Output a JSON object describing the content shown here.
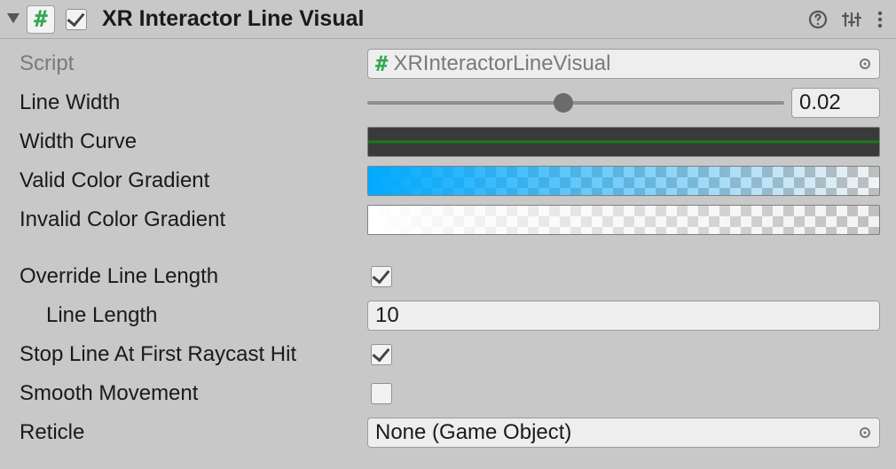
{
  "header": {
    "title": "XR Interactor Line Visual",
    "enabled": true
  },
  "fields": {
    "script_label": "Script",
    "script_value": "XRInteractorLineVisual",
    "line_width_label": "Line Width",
    "line_width_value": "0.02",
    "line_width_slider_pos": 47,
    "width_curve_label": "Width Curve",
    "valid_gradient_label": "Valid Color Gradient",
    "invalid_gradient_label": "Invalid Color Gradient",
    "override_label": "Override Line Length",
    "override_checked": true,
    "line_length_label": "Line Length",
    "line_length_value": "10",
    "stop_line_label": "Stop Line At First Raycast Hit",
    "stop_line_checked": true,
    "smooth_label": "Smooth Movement",
    "smooth_checked": false,
    "reticle_label": "Reticle",
    "reticle_value": "None (Game Object)"
  },
  "colors": {
    "valid_start": "#00aaff",
    "hash_green": "#34a853"
  }
}
